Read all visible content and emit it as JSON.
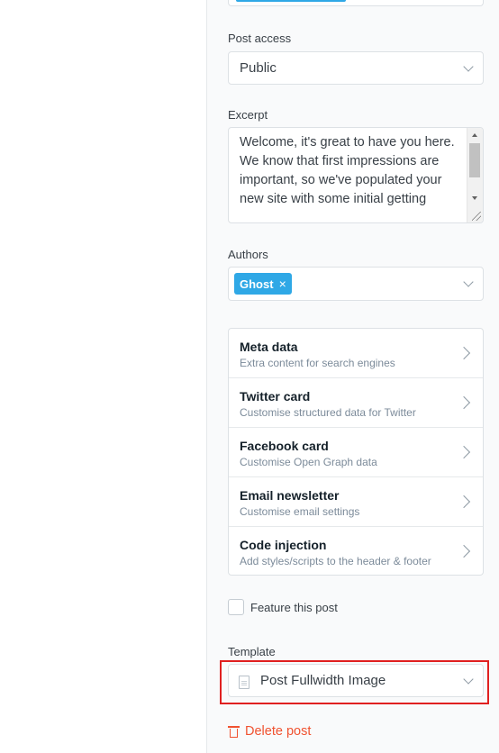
{
  "post_access": {
    "label": "Post access",
    "value": "Public"
  },
  "excerpt": {
    "label": "Excerpt",
    "value": "Welcome, it's great to have you here.\nWe know that first impressions are important, so we've populated your new site with some initial getting"
  },
  "authors": {
    "label": "Authors",
    "tags": [
      "Ghost"
    ],
    "remove_glyph": "×"
  },
  "menu_items": [
    {
      "title": "Meta data",
      "subtitle": "Extra content for search engines"
    },
    {
      "title": "Twitter card",
      "subtitle": "Customise structured data for Twitter"
    },
    {
      "title": "Facebook card",
      "subtitle": "Customise Open Graph data"
    },
    {
      "title": "Email newsletter",
      "subtitle": "Customise email settings"
    },
    {
      "title": "Code injection",
      "subtitle": "Add styles/scripts to the header & footer"
    }
  ],
  "feature": {
    "label": "Feature this post",
    "checked": false
  },
  "template": {
    "label": "Template",
    "value": "Post Fullwidth Image",
    "icon": "document-icon"
  },
  "delete_label": "Delete post",
  "colors": {
    "accent": "#2fa8e6",
    "danger": "#f05230",
    "highlight": "#e02020"
  }
}
